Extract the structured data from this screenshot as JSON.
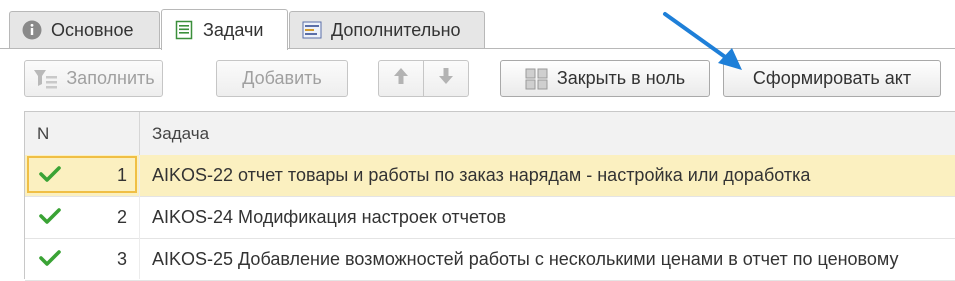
{
  "tabs": [
    {
      "label": "Основное",
      "icon": "info-icon"
    },
    {
      "label": "Задачи",
      "icon": "document-icon"
    },
    {
      "label": "Дополнительно",
      "icon": "settings-icon"
    }
  ],
  "toolbar": {
    "fill_label": "Заполнить",
    "add_label": "Добавить",
    "close_zero_label": "Закрыть в ноль",
    "create_act_label": "Сформировать акт"
  },
  "table": {
    "columns": [
      "N",
      "Задача"
    ],
    "rows": [
      {
        "n": "1",
        "task": "AIKOS-22 отчет товары и работы по заказ нарядам - настройка или доработка",
        "checked": true
      },
      {
        "n": "2",
        "task": "AIKOS-24 Модификация настроек отчетов",
        "checked": true
      },
      {
        "n": "3",
        "task": "AIKOS-25 Добавление возможностей работы с несколькими ценами в отчет по ценовому",
        "checked": true
      }
    ]
  },
  "colors": {
    "check_green": "#3aa335",
    "selected_row": "#fbf0c0",
    "cursor_border": "#f0bf45",
    "arrow_blue": "#1e7fd8"
  }
}
